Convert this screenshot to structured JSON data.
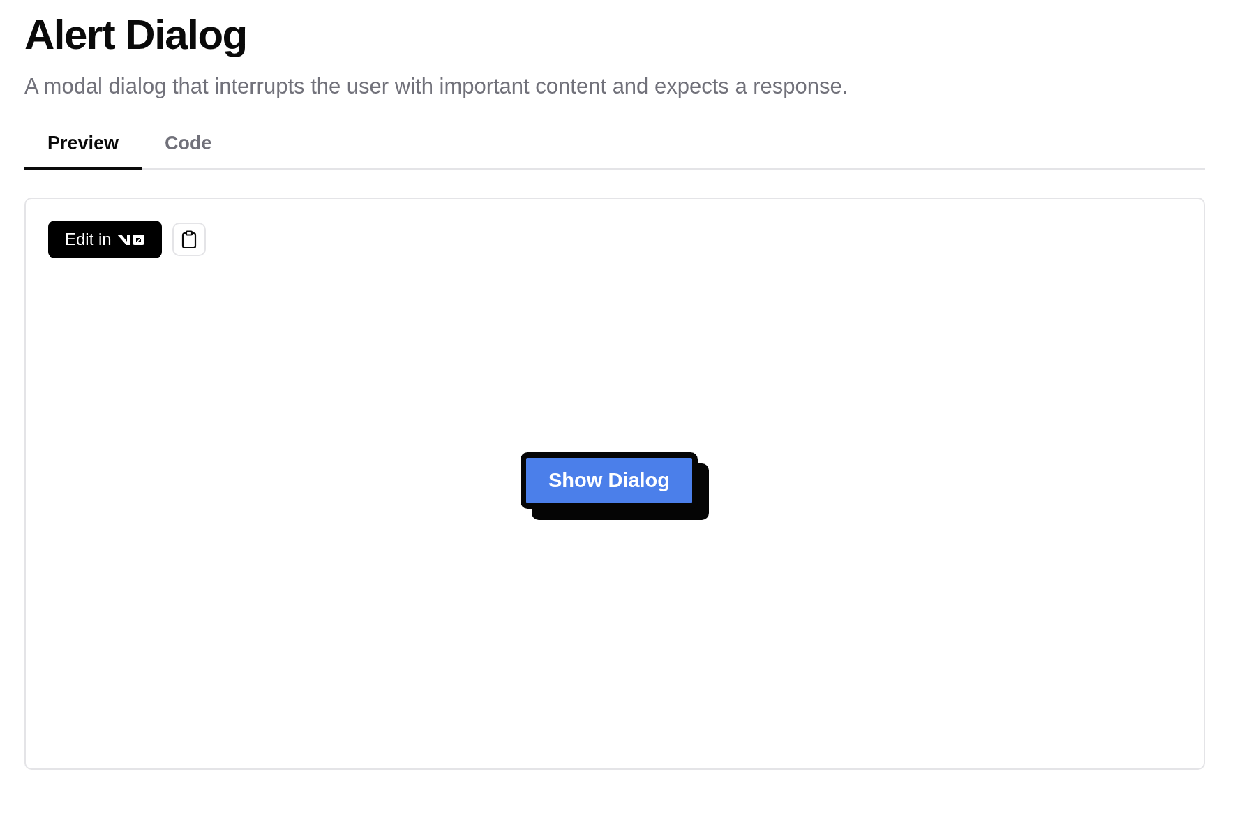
{
  "page": {
    "title": "Alert Dialog",
    "description": "A modal dialog that interrupts the user with important content and expects a response."
  },
  "tabs": [
    {
      "label": "Preview",
      "selected": true
    },
    {
      "label": "Code",
      "selected": false
    }
  ],
  "preview": {
    "edit_button": {
      "label": "Edit in"
    },
    "demo_button": {
      "label": "Show Dialog"
    }
  }
}
